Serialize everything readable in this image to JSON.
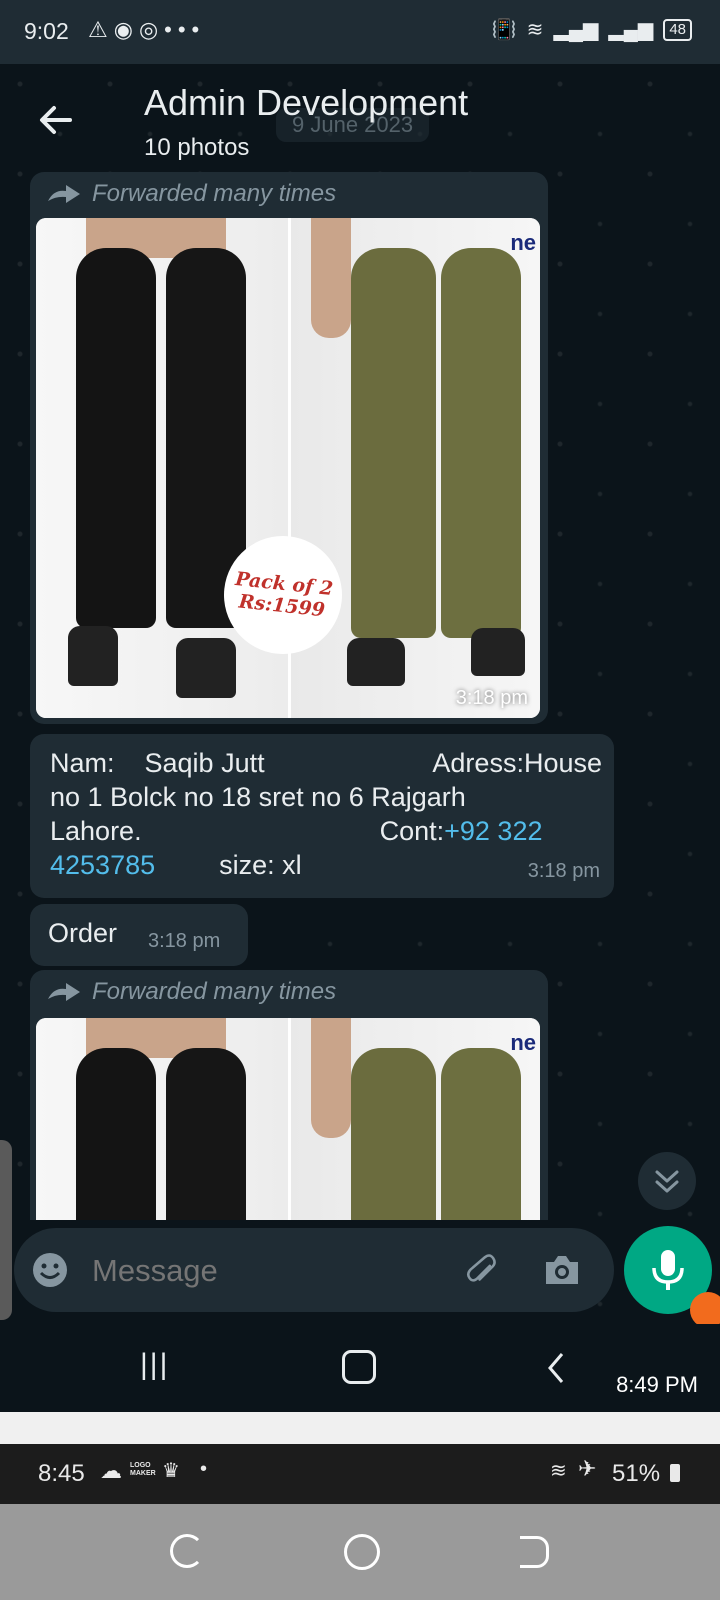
{
  "status_bar": {
    "time": "9:02",
    "battery": "48"
  },
  "header": {
    "title": "Admin Development",
    "subtitle": "10 photos",
    "date_chip": "9 June 2023"
  },
  "messages": {
    "forwarded_label": "Forwarded many times",
    "image1": {
      "badge_line1": "Pack of 2",
      "badge_line2": "Rs:1599",
      "brand": "ne",
      "time": "3:18 pm"
    },
    "text": {
      "line1_a": "Nam:    Saqib Jutt",
      "line1_b": "Adress:House",
      "line2": "no 1 Bolck no 18 sret no 6 Rajgarh",
      "line3_a": "Lahore.",
      "line3_b": "Cont:",
      "phone_a": "+92 322",
      "phone_b": "4253785",
      "size": "size: xl",
      "time": "3:18 pm"
    },
    "order": {
      "text": "Order",
      "time": "3:18 pm"
    },
    "image2": {
      "brand": "ne"
    }
  },
  "input": {
    "placeholder": "Message"
  },
  "nav_overlay_time": "8:49 PM",
  "outer_status": {
    "time": "8:45",
    "logo_text": "LOGO MAKER",
    "battery": "51%"
  },
  "colors": {
    "accent": "#00a884",
    "bubble": "#1f2c34",
    "link": "#53bdeb",
    "background": "#0b141a"
  }
}
